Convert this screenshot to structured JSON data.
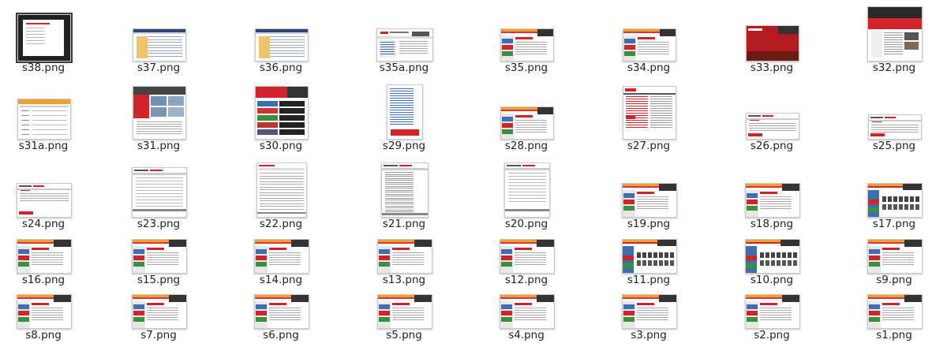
{
  "files": [
    {
      "name": "s38.png",
      "style": "dark"
    },
    {
      "name": "s37.png",
      "style": "table"
    },
    {
      "name": "s36.png",
      "style": "table"
    },
    {
      "name": "s35a.png",
      "style": "redlogo"
    },
    {
      "name": "s35.png",
      "style": "site"
    },
    {
      "name": "s34.png",
      "style": "site"
    },
    {
      "name": "s33.png",
      "style": "redbanner"
    },
    {
      "name": "s32.png",
      "style": "tallred"
    },
    {
      "name": "s31a.png",
      "style": "orangeform"
    },
    {
      "name": "s31.png",
      "style": "tiles"
    },
    {
      "name": "s30.png",
      "style": "redgrid"
    },
    {
      "name": "s29.png",
      "style": "bluelist"
    },
    {
      "name": "s28.png",
      "style": "site"
    },
    {
      "name": "s27.png",
      "style": "redtext"
    },
    {
      "name": "s26.png",
      "style": "minired"
    },
    {
      "name": "s25.png",
      "style": "minired"
    },
    {
      "name": "s24.png",
      "style": "minired"
    },
    {
      "name": "s23.png",
      "style": "form"
    },
    {
      "name": "s22.png",
      "style": "tablegray"
    },
    {
      "name": "s21.png",
      "style": "list"
    },
    {
      "name": "s20.png",
      "style": "form"
    },
    {
      "name": "s19.png",
      "style": "site"
    },
    {
      "name": "s18.png",
      "style": "site"
    },
    {
      "name": "s17.png",
      "style": "photos"
    },
    {
      "name": "s16.png",
      "style": "site"
    },
    {
      "name": "s15.png",
      "style": "site"
    },
    {
      "name": "s14.png",
      "style": "site"
    },
    {
      "name": "s13.png",
      "style": "site"
    },
    {
      "name": "s12.png",
      "style": "site"
    },
    {
      "name": "s11.png",
      "style": "photos"
    },
    {
      "name": "s10.png",
      "style": "photos"
    },
    {
      "name": "s9.png",
      "style": "site"
    },
    {
      "name": "s8.png",
      "style": "site"
    },
    {
      "name": "s7.png",
      "style": "site"
    },
    {
      "name": "s6.png",
      "style": "site"
    },
    {
      "name": "s5.png",
      "style": "site"
    },
    {
      "name": "s4.png",
      "style": "site"
    },
    {
      "name": "s3.png",
      "style": "site"
    },
    {
      "name": "s2.png",
      "style": "site"
    },
    {
      "name": "s1.png",
      "style": "site"
    }
  ],
  "colors": {
    "red": "#d2232a",
    "dark": "#1e1e1e",
    "blue": "#3d6fb6",
    "orange": "#f0a030",
    "green": "#3c8f3c",
    "label": "#222222"
  }
}
